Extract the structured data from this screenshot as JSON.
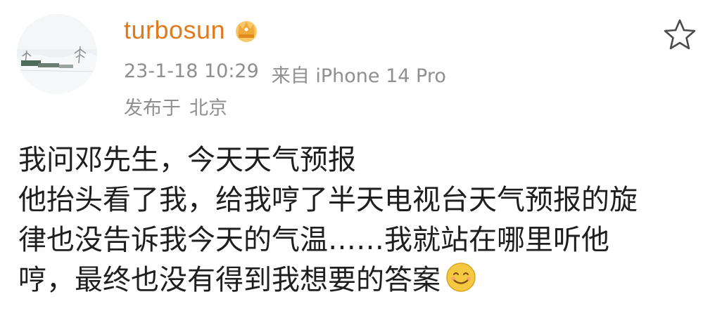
{
  "post": {
    "username": "turbosun",
    "badge_icon": "crown-icon",
    "date": "23-1-18 10:29",
    "source": "来自 iPhone 14 Pro",
    "location_prefix": "发布于",
    "location": "北京",
    "favorite_icon": "star-outline-icon",
    "content_lines": [
      "我问邓先生，今天天气预报",
      "他抬头看了我，给我哼了半天电视台天气预报的旋",
      "律也没告诉我今天的气温……我就站在哪里听他",
      "哼，最终也没有得到我想要的答案"
    ],
    "emoji_icon": "smiley-face-icon"
  },
  "colors": {
    "username": "#e07a1e",
    "meta_text": "#8f8f8f",
    "body_text": "#1e1e1e",
    "badge": "#f2a93b",
    "emoji": "#f5c842"
  }
}
